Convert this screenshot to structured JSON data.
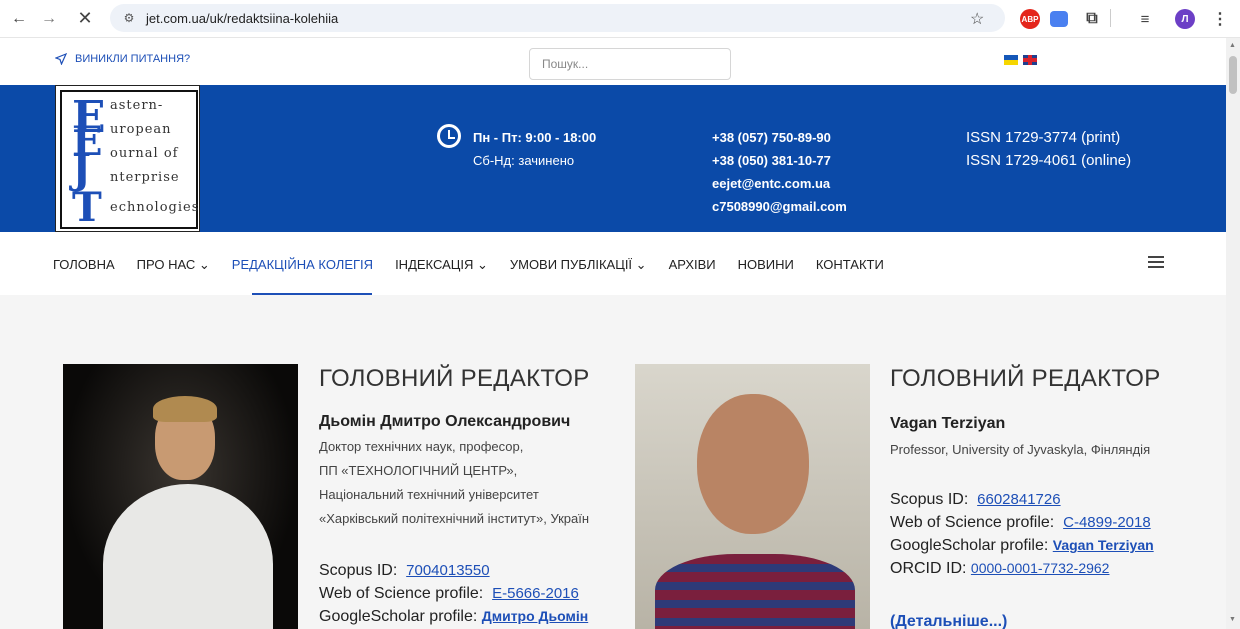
{
  "browser": {
    "url": "jet.com.ua/uk/redaktsiina-kolehiia",
    "back_icon": "←",
    "forward_icon": "→",
    "close_icon": "✕",
    "star_icon": "☆",
    "abp_label": "ABP",
    "profile_label": "Л",
    "menu_icon": "⋮"
  },
  "topbar": {
    "question_label": "ВИНИКЛИ ПИТАННЯ?",
    "search_placeholder": "Пошук..."
  },
  "header": {
    "logo": {
      "line1": "astern-",
      "line2": "uropean",
      "line3": "ournal of",
      "line4": "nterprise",
      "line5": "echnologies"
    },
    "hours_weekdays": "Пн - Пт: 9:00 - 18:00",
    "hours_weekend": "Сб-Нд: зачинено",
    "phone1": "+38 (057) 750-89-90",
    "phone2": "+38 (050) 381-10-77",
    "email1": "eejet@entc.com.ua",
    "email2": "c7508990@gmail.com",
    "issn_print": "ISSN 1729-3774 (print)",
    "issn_online": "ISSN 1729-4061 (online)"
  },
  "nav": {
    "items": [
      {
        "label": "ГОЛОВНА"
      },
      {
        "label": "ПРО НАС ⌄"
      },
      {
        "label": "РЕДАКЦІЙНА КОЛЕГІЯ"
      },
      {
        "label": "ІНДЕКСАЦІЯ ⌄"
      },
      {
        "label": "УМОВИ ПУБЛІКАЦІЇ ⌄"
      },
      {
        "label": "АРХІВИ"
      },
      {
        "label": "НОВИНИ"
      },
      {
        "label": "КОНТАКТИ"
      }
    ]
  },
  "editors": [
    {
      "title": "ГОЛОВНИЙ РЕДАКТОР",
      "name": "Дьомін Дмитро Олександрович",
      "desc1": "Доктор технічних наук, професор,",
      "desc2": "ПП «ТЕХНОЛОГІЧНИЙ ЦЕНТР»,",
      "desc3": "Національний технічний університет",
      "desc4": "«Харківський політехнічний інститут», Україн",
      "scopus_label": "Scopus ID:",
      "scopus_value": "7004013550",
      "wos_label": "Web of Science profile:",
      "wos_value": "E-5666-2016",
      "gs_label": "GoogleScholar profile:",
      "gs_value": "Дмитро Дьомін"
    },
    {
      "title": "ГОЛОВНИЙ РЕДАКТОР",
      "name": "Vagan Terziyan",
      "desc1": "Professor, University of Jyvaskyla, Фінляндія",
      "scopus_label": "Scopus ID:",
      "scopus_value": "6602841726",
      "wos_label": "Web of Science profile:",
      "wos_value": "C-4899-2018",
      "gs_label": "GoogleScholar profile:",
      "gs_value": "Vagan Terziyan",
      "orcid_label": "ORCID ID:",
      "orcid_value": "0000-0001-7732-2962",
      "more_label": "(Детальніше...)"
    }
  ]
}
